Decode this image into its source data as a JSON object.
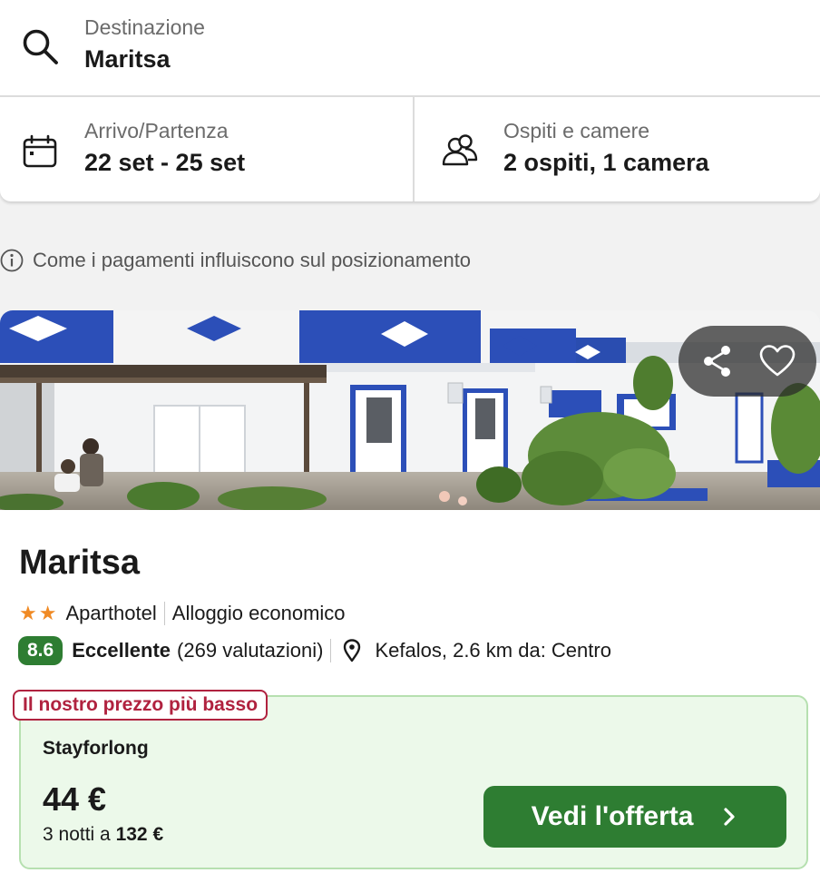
{
  "search": {
    "destination_label": "Destinazione",
    "destination_value": "Maritsa",
    "dates_label": "Arrivo/Partenza",
    "dates_value": "22 set - 25 set",
    "guests_label": "Ospiti e camere",
    "guests_value": "2 ospiti, 1 camera"
  },
  "notice": {
    "text": "Come i pagamenti influiscono sul posizionamento"
  },
  "hotel": {
    "name": "Maritsa",
    "stars": 2,
    "type": "Aparthotel",
    "category": "Alloggio economico",
    "score": "8.6",
    "rating_word": "Eccellente",
    "reviews": "(269 valutazioni)",
    "location": "Kefalos, 2.6 km da: Centro"
  },
  "offer": {
    "tag": "Il nostro prezzo più basso",
    "provider": "Stayforlong",
    "price": "44 €",
    "nights_prefix": "3 notti a",
    "total": "132 €",
    "button_label": "Vedi l'offerta"
  },
  "colors": {
    "accent_green": "#2e7d32",
    "tag_red": "#b0223f",
    "offer_bg": "#ecf9ea",
    "star_orange": "#f08a24"
  },
  "icons": {
    "search": "search-icon",
    "calendar": "calendar-icon",
    "guests": "people-icon",
    "info": "info-icon",
    "share": "share-icon",
    "favorite": "heart-icon",
    "location": "map-pin-icon",
    "chevron": "chevron-right-icon"
  }
}
